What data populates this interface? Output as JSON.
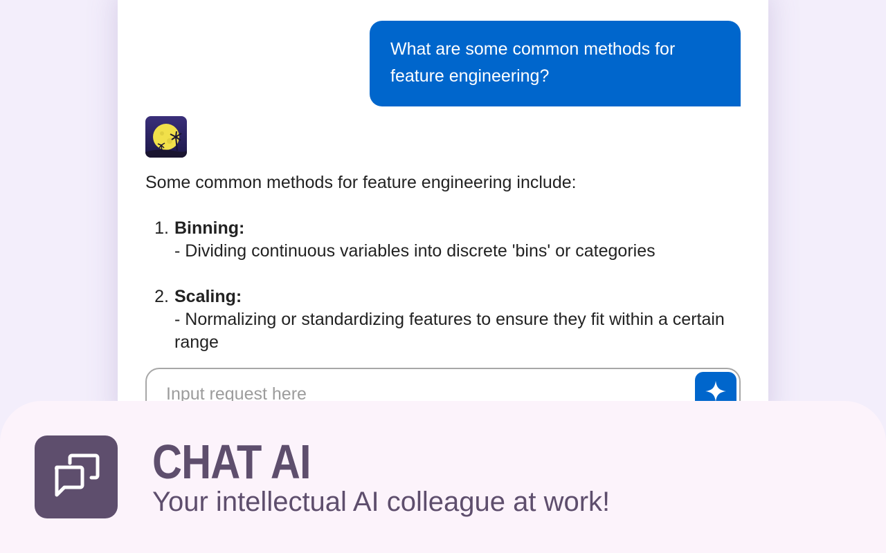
{
  "conversation": {
    "user_message": "What are some common methods for feature engineering?",
    "bot_avatar_icon": "moon-palm-tree-avatar",
    "bot_answer": {
      "intro": "Some common methods for feature engineering include:",
      "items": [
        {
          "number": "1.",
          "title": "Binning:",
          "text": "- Dividing continuous variables into discrete 'bins' or categories"
        },
        {
          "number": "2.",
          "title": "Scaling:",
          "text": "- Normalizing or standardizing features to ensure they fit within a certain range"
        }
      ]
    }
  },
  "input": {
    "placeholder": "Input request here",
    "value": "",
    "send_icon": "sparkle-icon"
  },
  "banner": {
    "logo_icon": "chat-bubbles-icon",
    "title": "CHAT AI",
    "tagline": "Your intellectual AI colleague at work!"
  },
  "colors": {
    "accent_blue": "#0066cc",
    "brand_purple": "#5e4e6d",
    "page_background": "#f3eefb",
    "banner_background": "#fcf3fb"
  }
}
